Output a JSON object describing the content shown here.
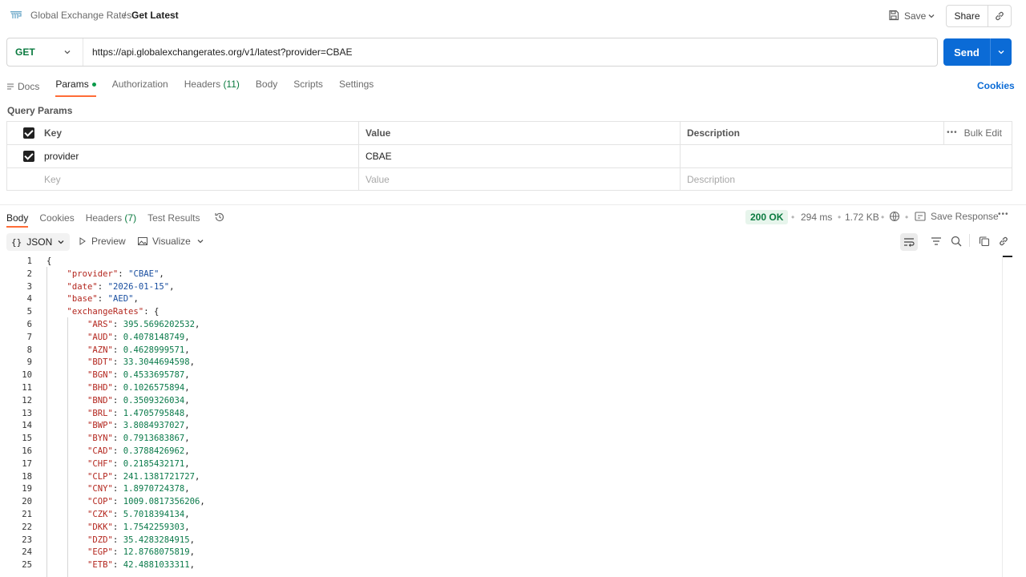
{
  "breadcrumb": {
    "parent": "Global Exchange Rates",
    "separator": "/",
    "current": "Get Latest"
  },
  "toolbar": {
    "save_label": "Save",
    "share_label": "Share"
  },
  "request": {
    "method": "GET",
    "url": "https://api.globalexchangerates.org/v1/latest?provider=CBAE",
    "send_label": "Send"
  },
  "request_tabs": {
    "docs": "Docs",
    "params": "Params",
    "authorization": "Authorization",
    "headers": "Headers",
    "headers_count": "(11)",
    "body": "Body",
    "scripts": "Scripts",
    "settings": "Settings",
    "cookies": "Cookies"
  },
  "query_params": {
    "title": "Query Params",
    "columns": {
      "key": "Key",
      "value": "Value",
      "description": "Description"
    },
    "bulk_edit": "Bulk Edit",
    "rows": [
      {
        "key": "provider",
        "value": "CBAE",
        "description": ""
      }
    ],
    "placeholders": {
      "key": "Key",
      "value": "Value",
      "description": "Description"
    }
  },
  "response_tabs": {
    "body": "Body",
    "cookies": "Cookies",
    "headers": "Headers",
    "headers_count": "(7)",
    "test_results": "Test Results"
  },
  "response_meta": {
    "status": "200 OK",
    "time": "294 ms",
    "size": "1.72 KB",
    "save_response": "Save Response",
    "status_color": "#0a7a3f"
  },
  "body_toolbar": {
    "format": "JSON",
    "preview": "Preview",
    "visualize": "Visualize"
  },
  "code_lines": [
    {
      "n": "1",
      "t": [
        [
          "p",
          "{"
        ]
      ]
    },
    {
      "n": "2",
      "t": [
        [
          "p",
          "    "
        ],
        [
          "k",
          "\"provider\""
        ],
        [
          "p",
          ": "
        ],
        [
          "s",
          "\"CBAE\""
        ],
        [
          "p",
          ","
        ]
      ]
    },
    {
      "n": "3",
      "t": [
        [
          "p",
          "    "
        ],
        [
          "k",
          "\"date\""
        ],
        [
          "p",
          ": "
        ],
        [
          "s",
          "\"2026-01-15\""
        ],
        [
          "p",
          ","
        ]
      ]
    },
    {
      "n": "4",
      "t": [
        [
          "p",
          "    "
        ],
        [
          "k",
          "\"base\""
        ],
        [
          "p",
          ": "
        ],
        [
          "s",
          "\"AED\""
        ],
        [
          "p",
          ","
        ]
      ]
    },
    {
      "n": "5",
      "t": [
        [
          "p",
          "    "
        ],
        [
          "k",
          "\"exchangeRates\""
        ],
        [
          "p",
          ": {"
        ]
      ]
    },
    {
      "n": "6",
      "t": [
        [
          "p",
          "        "
        ],
        [
          "k",
          "\"ARS\""
        ],
        [
          "p",
          ": "
        ],
        [
          "v",
          "395.5696202532"
        ],
        [
          "p",
          ","
        ]
      ]
    },
    {
      "n": "7",
      "t": [
        [
          "p",
          "        "
        ],
        [
          "k",
          "\"AUD\""
        ],
        [
          "p",
          ": "
        ],
        [
          "v",
          "0.4078148749"
        ],
        [
          "p",
          ","
        ]
      ]
    },
    {
      "n": "8",
      "t": [
        [
          "p",
          "        "
        ],
        [
          "k",
          "\"AZN\""
        ],
        [
          "p",
          ": "
        ],
        [
          "v",
          "0.4628999571"
        ],
        [
          "p",
          ","
        ]
      ]
    },
    {
      "n": "9",
      "t": [
        [
          "p",
          "        "
        ],
        [
          "k",
          "\"BDT\""
        ],
        [
          "p",
          ": "
        ],
        [
          "v",
          "33.3044694598"
        ],
        [
          "p",
          ","
        ]
      ]
    },
    {
      "n": "10",
      "t": [
        [
          "p",
          "        "
        ],
        [
          "k",
          "\"BGN\""
        ],
        [
          "p",
          ": "
        ],
        [
          "v",
          "0.4533695787"
        ],
        [
          "p",
          ","
        ]
      ]
    },
    {
      "n": "11",
      "t": [
        [
          "p",
          "        "
        ],
        [
          "k",
          "\"BHD\""
        ],
        [
          "p",
          ": "
        ],
        [
          "v",
          "0.1026575894"
        ],
        [
          "p",
          ","
        ]
      ]
    },
    {
      "n": "12",
      "t": [
        [
          "p",
          "        "
        ],
        [
          "k",
          "\"BND\""
        ],
        [
          "p",
          ": "
        ],
        [
          "v",
          "0.3509326034"
        ],
        [
          "p",
          ","
        ]
      ]
    },
    {
      "n": "13",
      "t": [
        [
          "p",
          "        "
        ],
        [
          "k",
          "\"BRL\""
        ],
        [
          "p",
          ": "
        ],
        [
          "v",
          "1.4705795848"
        ],
        [
          "p",
          ","
        ]
      ]
    },
    {
      "n": "14",
      "t": [
        [
          "p",
          "        "
        ],
        [
          "k",
          "\"BWP\""
        ],
        [
          "p",
          ": "
        ],
        [
          "v",
          "3.8084937027"
        ],
        [
          "p",
          ","
        ]
      ]
    },
    {
      "n": "15",
      "t": [
        [
          "p",
          "        "
        ],
        [
          "k",
          "\"BYN\""
        ],
        [
          "p",
          ": "
        ],
        [
          "v",
          "0.7913683867"
        ],
        [
          "p",
          ","
        ]
      ]
    },
    {
      "n": "16",
      "t": [
        [
          "p",
          "        "
        ],
        [
          "k",
          "\"CAD\""
        ],
        [
          "p",
          ": "
        ],
        [
          "v",
          "0.3788426962"
        ],
        [
          "p",
          ","
        ]
      ]
    },
    {
      "n": "17",
      "t": [
        [
          "p",
          "        "
        ],
        [
          "k",
          "\"CHF\""
        ],
        [
          "p",
          ": "
        ],
        [
          "v",
          "0.2185432171"
        ],
        [
          "p",
          ","
        ]
      ]
    },
    {
      "n": "18",
      "t": [
        [
          "p",
          "        "
        ],
        [
          "k",
          "\"CLP\""
        ],
        [
          "p",
          ": "
        ],
        [
          "v",
          "241.1381721727"
        ],
        [
          "p",
          ","
        ]
      ]
    },
    {
      "n": "19",
      "t": [
        [
          "p",
          "        "
        ],
        [
          "k",
          "\"CNY\""
        ],
        [
          "p",
          ": "
        ],
        [
          "v",
          "1.8970724378"
        ],
        [
          "p",
          ","
        ]
      ]
    },
    {
      "n": "20",
      "t": [
        [
          "p",
          "        "
        ],
        [
          "k",
          "\"COP\""
        ],
        [
          "p",
          ": "
        ],
        [
          "v",
          "1009.0817356206"
        ],
        [
          "p",
          ","
        ]
      ]
    },
    {
      "n": "21",
      "t": [
        [
          "p",
          "        "
        ],
        [
          "k",
          "\"CZK\""
        ],
        [
          "p",
          ": "
        ],
        [
          "v",
          "5.7018394134"
        ],
        [
          "p",
          ","
        ]
      ]
    },
    {
      "n": "22",
      "t": [
        [
          "p",
          "        "
        ],
        [
          "k",
          "\"DKK\""
        ],
        [
          "p",
          ": "
        ],
        [
          "v",
          "1.7542259303"
        ],
        [
          "p",
          ","
        ]
      ]
    },
    {
      "n": "23",
      "t": [
        [
          "p",
          "        "
        ],
        [
          "k",
          "\"DZD\""
        ],
        [
          "p",
          ": "
        ],
        [
          "v",
          "35.4283284915"
        ],
        [
          "p",
          ","
        ]
      ]
    },
    {
      "n": "24",
      "t": [
        [
          "p",
          "        "
        ],
        [
          "k",
          "\"EGP\""
        ],
        [
          "p",
          ": "
        ],
        [
          "v",
          "12.8768075819"
        ],
        [
          "p",
          ","
        ]
      ]
    },
    {
      "n": "25",
      "t": [
        [
          "p",
          "        "
        ],
        [
          "k",
          "\"ETB\""
        ],
        [
          "p",
          ": "
        ],
        [
          "v",
          "42.4881033311"
        ],
        [
          "p",
          ","
        ]
      ]
    }
  ]
}
